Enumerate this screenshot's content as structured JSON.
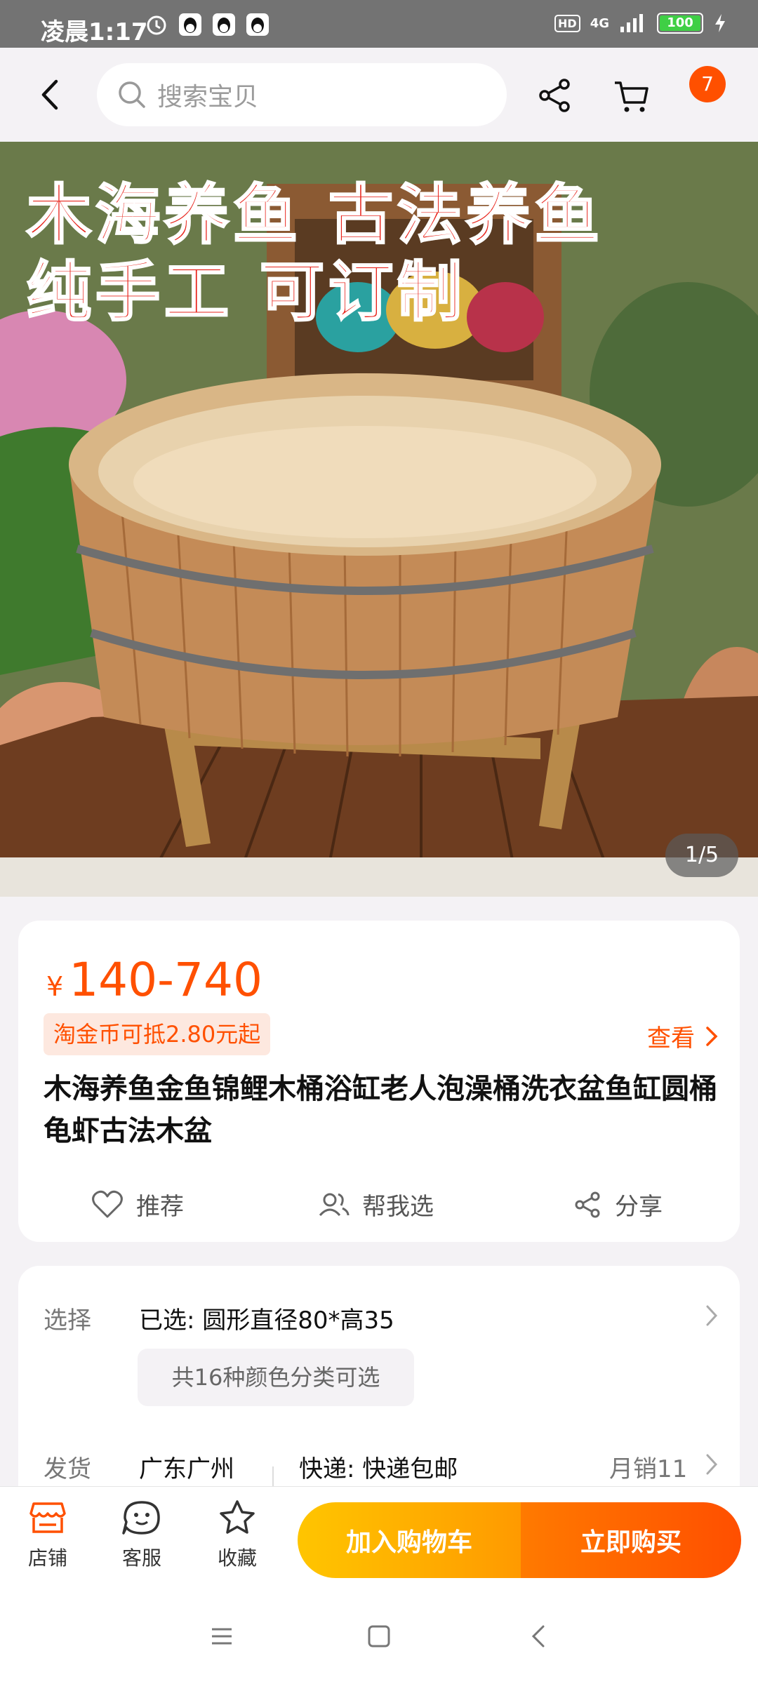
{
  "status_bar": {
    "time": "凌晨1:17",
    "hd": "HD",
    "network": "4G",
    "battery": "100",
    "battery_level": 1.0
  },
  "header": {
    "search_placeholder": "搜索宝贝",
    "cart_badge": "7"
  },
  "hero": {
    "line1": "木海养鱼 古法养鱼",
    "line2": "纯手工 可订制",
    "pager": "1/5"
  },
  "product": {
    "currency": "¥",
    "price": "140-740",
    "coupon": "淘金币可抵2.80元起",
    "view_label": "查看",
    "title": "木海养鱼金鱼锦鲤木桶浴缸老人泡澡桶洗衣盆鱼缸圆桶龟虾古法木盆",
    "actions": [
      {
        "label": "推荐",
        "icon": "heart-icon"
      },
      {
        "label": "帮我选",
        "icon": "people-icon"
      },
      {
        "label": "分享",
        "icon": "share-icon"
      }
    ]
  },
  "options": {
    "select_label": "选择",
    "selected": "已选: 圆形直径80*高35",
    "variants_chip": "共16种颜色分类可选",
    "ship_label": "发货",
    "origin": "广东广州",
    "delivery": "快递: 快递包邮",
    "monthly_sales": "月销11"
  },
  "bottom_bar": {
    "store": "店铺",
    "service": "客服",
    "favorite": "收藏",
    "add_to_cart": "加入购物车",
    "buy_now": "立即购买"
  },
  "colors": {
    "accent": "#ff5000",
    "cart_gradient_start": "#ffc500",
    "buy_gradient_end": "#ff4f00"
  }
}
